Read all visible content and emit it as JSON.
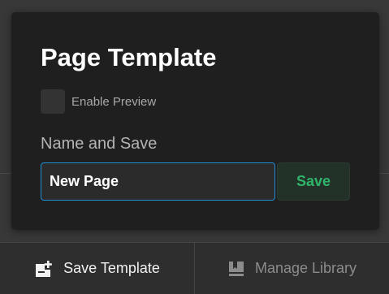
{
  "modal": {
    "title": "Page Template",
    "preview_checkbox": {
      "label": "Enable Preview",
      "checked": false
    },
    "name_section_label": "Name and Save",
    "name_input": {
      "value": "New Page"
    },
    "save_label": "Save"
  },
  "bottom_bar": {
    "save_template": {
      "label": "Save Template",
      "icon": "page-add-icon"
    },
    "manage_library": {
      "label": "Manage Library",
      "icon": "library-icon"
    }
  },
  "colors": {
    "accent_blue": "#1e8fd6",
    "save_green": "#2fb56a",
    "modal_bg": "#1f1f1f"
  }
}
